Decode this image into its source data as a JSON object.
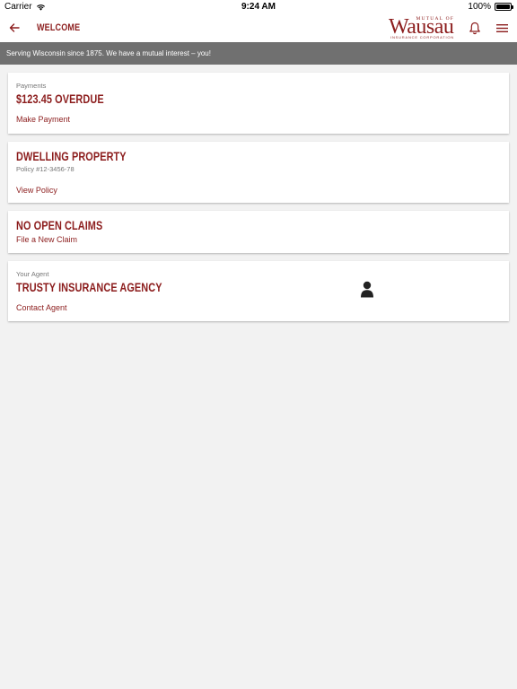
{
  "status_bar": {
    "carrier": "Carrier",
    "time": "9:24 AM",
    "battery": "100%"
  },
  "nav": {
    "title": "WELCOME",
    "logo": {
      "top": "MUTUAL OF",
      "main": "Wausau",
      "sub": "INSURANCE CORPORATION"
    }
  },
  "banner": {
    "text": "Serving Wisconsin since 1875. We have a mutual interest – you!"
  },
  "cards": {
    "payments": {
      "label": "Payments",
      "title": "$123.45 OVERDUE",
      "link": "Make Payment"
    },
    "policy": {
      "title": "DWELLING PROPERTY",
      "sub": "Policy #12-3456-78",
      "link": "View Policy"
    },
    "claims": {
      "title": "NO OPEN CLAIMS",
      "link": "File a New Claim"
    },
    "agent": {
      "label": "Your Agent",
      "title": "TRUSTY INSURANCE AGENCY",
      "link": "Contact Agent"
    }
  },
  "colors": {
    "brand": "#8c1d1d",
    "banner_bg": "#707070",
    "page_bg": "#f2f2f2"
  },
  "icons": {
    "back": "arrow-left-icon",
    "notifications": "bell-icon",
    "menu": "hamburger-menu-icon",
    "agent": "person-icon",
    "wifi": "wifi-icon",
    "battery": "battery-icon"
  }
}
